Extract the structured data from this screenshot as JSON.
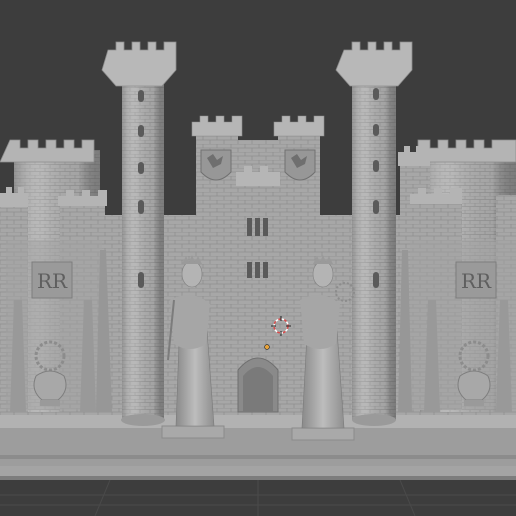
{
  "viewport": {
    "name": "3D Viewport",
    "background": "#3d3d3d",
    "grid_color": "#4a4a4a",
    "model_color": "#a7a7a7",
    "shadow_color": "#7f7f7f",
    "highlight_color": "#bdbdbd"
  },
  "scene": {
    "objects": [
      {
        "label": "castle-model"
      },
      {
        "label": "left-round-tower"
      },
      {
        "label": "right-round-tower"
      },
      {
        "label": "central-gatehouse"
      },
      {
        "label": "left-statue"
      },
      {
        "label": "right-statue"
      },
      {
        "label": "left-urn"
      },
      {
        "label": "right-urn"
      },
      {
        "label": "left-monogram-panel"
      },
      {
        "label": "right-monogram-panel"
      }
    ],
    "monogram_left": "RR",
    "monogram_right": "RR"
  },
  "overlay": {
    "cursor": "3d-cursor-icon",
    "origin": "origin-dot-icon",
    "origin_color": "#e8a33a",
    "cursor_color": "#d94b4b"
  }
}
